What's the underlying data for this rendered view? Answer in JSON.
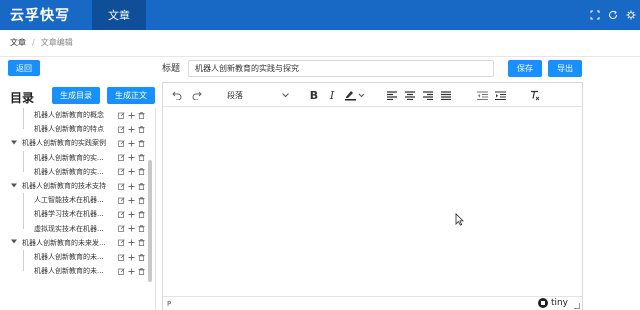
{
  "app": {
    "brand": "云孚快写",
    "nav_tab": "文章"
  },
  "breadcrumb": {
    "root": "文章",
    "separator": "/",
    "current": "文章编辑"
  },
  "actions": {
    "back": "返回",
    "save": "保存",
    "export": "导出"
  },
  "title_field": {
    "label": "标题",
    "value": "机器人创新教育的实践与探究"
  },
  "toc": {
    "heading": "目录",
    "gen_outline": "生成目录",
    "gen_body": "生成正文",
    "items": [
      {
        "label": "机器人创新教育的概念",
        "level": 2
      },
      {
        "label": "机器人创新教育的特点",
        "level": 2
      },
      {
        "label": "机器人创新教育的实践案例",
        "level": 1
      },
      {
        "label": "机器人创新教育的实...",
        "level": 2
      },
      {
        "label": "机器人创新教育的实...",
        "level": 2
      },
      {
        "label": "机器人创新教育的技术支持",
        "level": 1
      },
      {
        "label": "人工智能技术在机器...",
        "level": 2
      },
      {
        "label": "机器学习技术在机器...",
        "level": 2
      },
      {
        "label": "虚拟现实技术在机器...",
        "level": 2
      },
      {
        "label": "机器人创新教育的未来发...",
        "level": 1
      },
      {
        "label": "机器人创新教育的未...",
        "level": 2
      },
      {
        "label": "机器人创新教育的未...",
        "level": 2
      }
    ],
    "expand_icon": "caret-down-icon",
    "row_action_icons": [
      "edit-icon",
      "plus-icon",
      "trash-icon"
    ]
  },
  "editor": {
    "block_format": "段落",
    "toolbar_icons": [
      "undo-icon",
      "redo-icon",
      "bold-icon",
      "italic-icon",
      "text-color-icon",
      "align-left-icon",
      "align-center-icon",
      "align-right-icon",
      "align-justify-icon",
      "outdent-icon",
      "indent-icon",
      "clear-format-icon"
    ],
    "status_path": "P",
    "branding": "tiny"
  },
  "colors": {
    "topbar": "#1769c5",
    "nav_active": "#0f4f9a",
    "primary_button": "#1890ff"
  }
}
